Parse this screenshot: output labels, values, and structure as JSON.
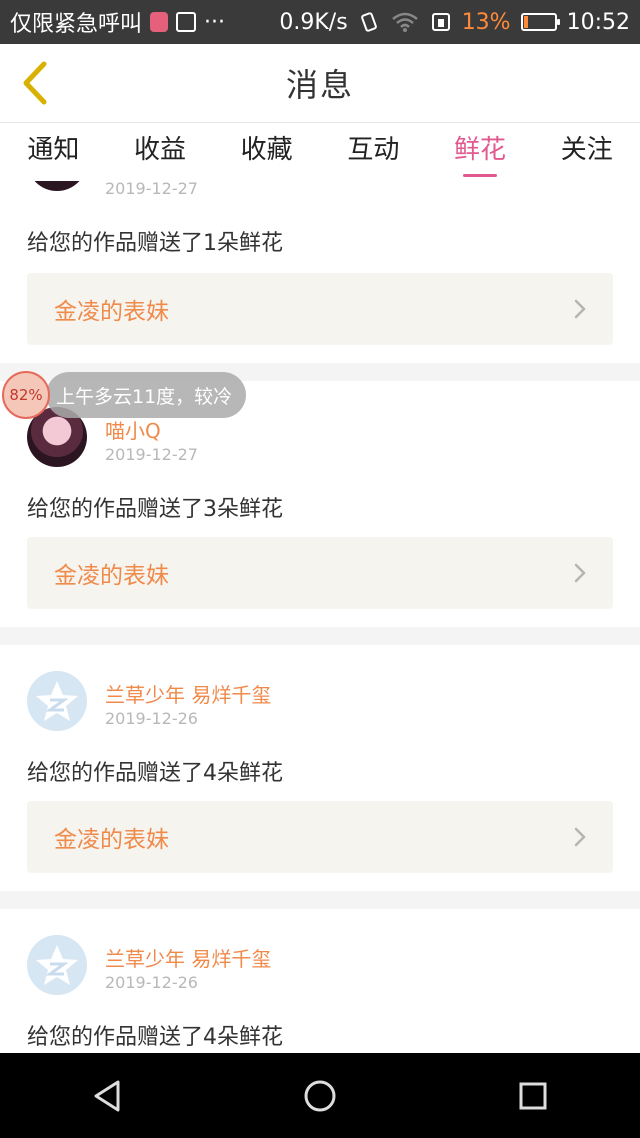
{
  "status_bar": {
    "carrier_text": "仅限紧急呼叫",
    "more": "···",
    "network_speed": "0.9K/s",
    "battery_percent": "13%",
    "time": "10:52",
    "battery_level": 0.13,
    "battery_color": "#ff8a3a"
  },
  "header": {
    "title": "消息",
    "back_icon": "chevron-left-icon",
    "back_color": "#d9b100"
  },
  "tabs": [
    {
      "label": "通知",
      "active": false
    },
    {
      "label": "收益",
      "active": false
    },
    {
      "label": "收藏",
      "active": false
    },
    {
      "label": "互动",
      "active": false
    },
    {
      "label": "鲜花",
      "active": true
    },
    {
      "label": "关注",
      "active": false
    }
  ],
  "accent_color": "#e05a8f",
  "feed": [
    {
      "username": "",
      "date": "2019-12-27",
      "message": "给您的作品赠送了1朵鲜花",
      "work_title": "金凌的表妹",
      "avatar": "anime-avatar"
    },
    {
      "username": "喵小Q",
      "date": "2019-12-27",
      "message": "给您的作品赠送了3朵鲜花",
      "work_title": "金凌的表妹",
      "avatar": "anime-avatar"
    },
    {
      "username": "兰草少年 易烊千玺",
      "date": "2019-12-26",
      "message": "给您的作品赠送了4朵鲜花",
      "work_title": "金凌的表妹",
      "avatar": "qzone-avatar"
    },
    {
      "username": "兰草少年 易烊千玺",
      "date": "2019-12-26",
      "message": "给您的作品赠送了4朵鲜花",
      "work_title": "",
      "avatar": "qzone-avatar"
    }
  ],
  "weather_popup": {
    "percent": "82%",
    "text": "上午多云11度，较冷"
  },
  "nav_bar": {
    "back_icon": "triangle-back-icon",
    "home_icon": "circle-home-icon",
    "recent_icon": "square-recents-icon"
  }
}
